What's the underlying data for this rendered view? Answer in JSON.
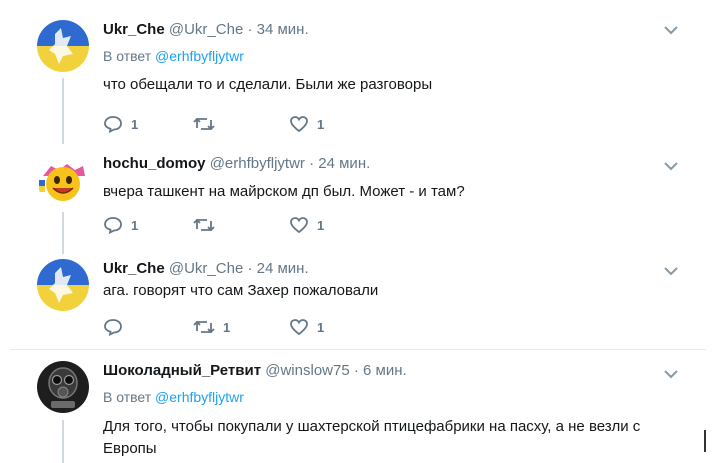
{
  "tweets": [
    {
      "name": "Ukr_Che",
      "handle": "@Ukr_Che",
      "time": "· 34 мин.",
      "reply_prefix": "В ответ",
      "reply_handle": "@erhfbyfljytwr",
      "text": "что обещали то и сделали. Были же разговоры",
      "replies": "1",
      "retweets": "",
      "likes": "1",
      "avatar": "flag-wolf-avatar"
    },
    {
      "name": "hochu_domoy",
      "handle": "@erhfbyfljytwr",
      "time": "· 24 мин.",
      "text": "вчера ташкент на майрском дп был. Может - и там?",
      "replies": "1",
      "retweets": "",
      "likes": "1",
      "avatar": "smiley-avatar"
    },
    {
      "name": "Ukr_Che",
      "handle": "@Ukr_Che",
      "time": "· 24 мин.",
      "text": "ага. говорят что сам Захер пожаловали",
      "replies": "",
      "retweets": "1",
      "likes": "1",
      "avatar": "flag-wolf-avatar"
    },
    {
      "name": "Шоколадный_Ретвит",
      "handle": "@winslow75",
      "time": "· 6 мин.",
      "reply_prefix": "В ответ",
      "reply_handle": "@erhfbyfljytwr",
      "text": "Для того, чтобы покупали у шахтерской птицефабрики на пасху, а не везли с Европы",
      "avatar": "gasmask-avatar"
    }
  ],
  "colors": {
    "link": "#1da1f2",
    "muted": "#657786",
    "text": "#14171a",
    "thread_line": "#cfd9de",
    "flag_blue": "#2f6ad0",
    "flag_yellow": "#f2d23c"
  }
}
